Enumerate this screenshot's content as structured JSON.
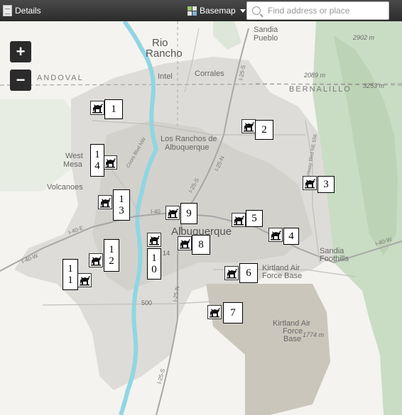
{
  "toolbar": {
    "details_label": "Details",
    "basemap_label": "Basemap",
    "search_placeholder": "Find address or place"
  },
  "zoom": {
    "in_label": "+",
    "out_label": "−"
  },
  "map_labels": {
    "rio_rancho_1": "Rio",
    "rio_rancho_2": "Rancho",
    "sandia_pueblo_1": "Sandia",
    "sandia_pueblo_2": "Pueblo",
    "intel": "Intel",
    "corrales": "Corrales",
    "sandoval": "ANDOVAL",
    "bernalillo": "BERNALILLO",
    "los_ranchos_1": "Los Ranchos de",
    "los_ranchos_2": "Albuquerque",
    "west_mesa_1": "West",
    "west_mesa_2": "Mesa",
    "volcanoes": "Volcanoes",
    "albuquerque": "Albuquerque",
    "kirtland_afb_1": "Kirtland Air",
    "kirtland_afb_2": "Force Base",
    "kirtland_afb2_1": "Kirtland Air",
    "kirtland_afb2_2": "Force",
    "kirtland_afb2_3": "Base",
    "sandia_foothills_1": "Sandia",
    "sandia_foothills_2": "Foothills",
    "route_500": "500",
    "route_14": "14"
  },
  "elevations": [
    "2902 m",
    "2089 m",
    "3253 m",
    "1774 m"
  ],
  "roads": {
    "i25_north": "I-25-S",
    "i25_mid": "I-25-S",
    "i25_n": "I-25-N",
    "i40_w": "I-40-W",
    "i40_e": "I-40-E",
    "i40_center": "I-40",
    "i40_east": "I-40-W",
    "i25_south": "I-25-N",
    "i25_far_south": "I-25-S",
    "nm528": "Coors Blvd NW",
    "nm556": "Tramway Blvd NE 556"
  },
  "markers": [
    {
      "id": "1",
      "digits": [
        "1"
      ]
    },
    {
      "id": "2",
      "digits": [
        "2"
      ]
    },
    {
      "id": "3",
      "digits": [
        "3"
      ]
    },
    {
      "id": "4",
      "digits": [
        "4"
      ]
    },
    {
      "id": "5",
      "digits": [
        "5"
      ]
    },
    {
      "id": "6",
      "digits": [
        "6"
      ]
    },
    {
      "id": "7",
      "digits": [
        "7"
      ]
    },
    {
      "id": "8",
      "digits": [
        "8"
      ]
    },
    {
      "id": "9",
      "digits": [
        "9"
      ]
    },
    {
      "id": "10",
      "digits": [
        "1",
        "0"
      ]
    },
    {
      "id": "11",
      "digits": [
        "1",
        "1"
      ]
    },
    {
      "id": "12",
      "digits": [
        "1",
        "2"
      ]
    },
    {
      "id": "13",
      "digits": [
        "1",
        "3"
      ]
    },
    {
      "id": "14",
      "digits": [
        "1",
        "4"
      ]
    }
  ],
  "colors": {
    "topbar": "#2b2b2b",
    "river": "#8fd6e3",
    "urban": "#d9d8d4",
    "terrain": "#c9dcc4",
    "military": "#cbc6bc"
  }
}
